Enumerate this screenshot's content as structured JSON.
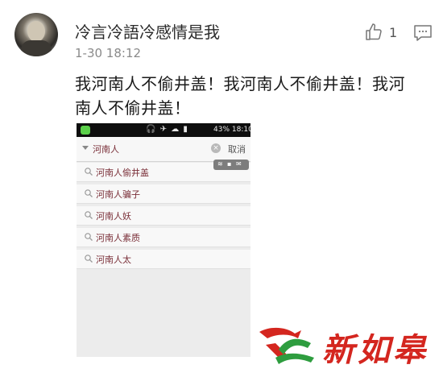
{
  "comment": {
    "username": "冷言冷語冷感情是我",
    "timestamp": "1-30 18:12",
    "like_count": "1",
    "text": "我河南人不偷井盖！我河南人不偷井盖！我河南人不偷井盖！",
    "icons": {
      "like": "thumbs-up-icon",
      "reply": "comment-bubble-icon"
    }
  },
  "embedded_screenshot": {
    "status_bar": {
      "battery": "43%",
      "time": "18:10"
    },
    "search": {
      "value": "河南人",
      "cancel_label": "取消"
    },
    "suggestions": [
      "河南人偷井盖",
      "河南人骗子",
      "河南人妖",
      "河南人素质",
      "河南人太"
    ]
  },
  "watermark": {
    "text": "新如皋",
    "colors": {
      "red": "#d4261f",
      "green": "#2e9d3f"
    }
  }
}
